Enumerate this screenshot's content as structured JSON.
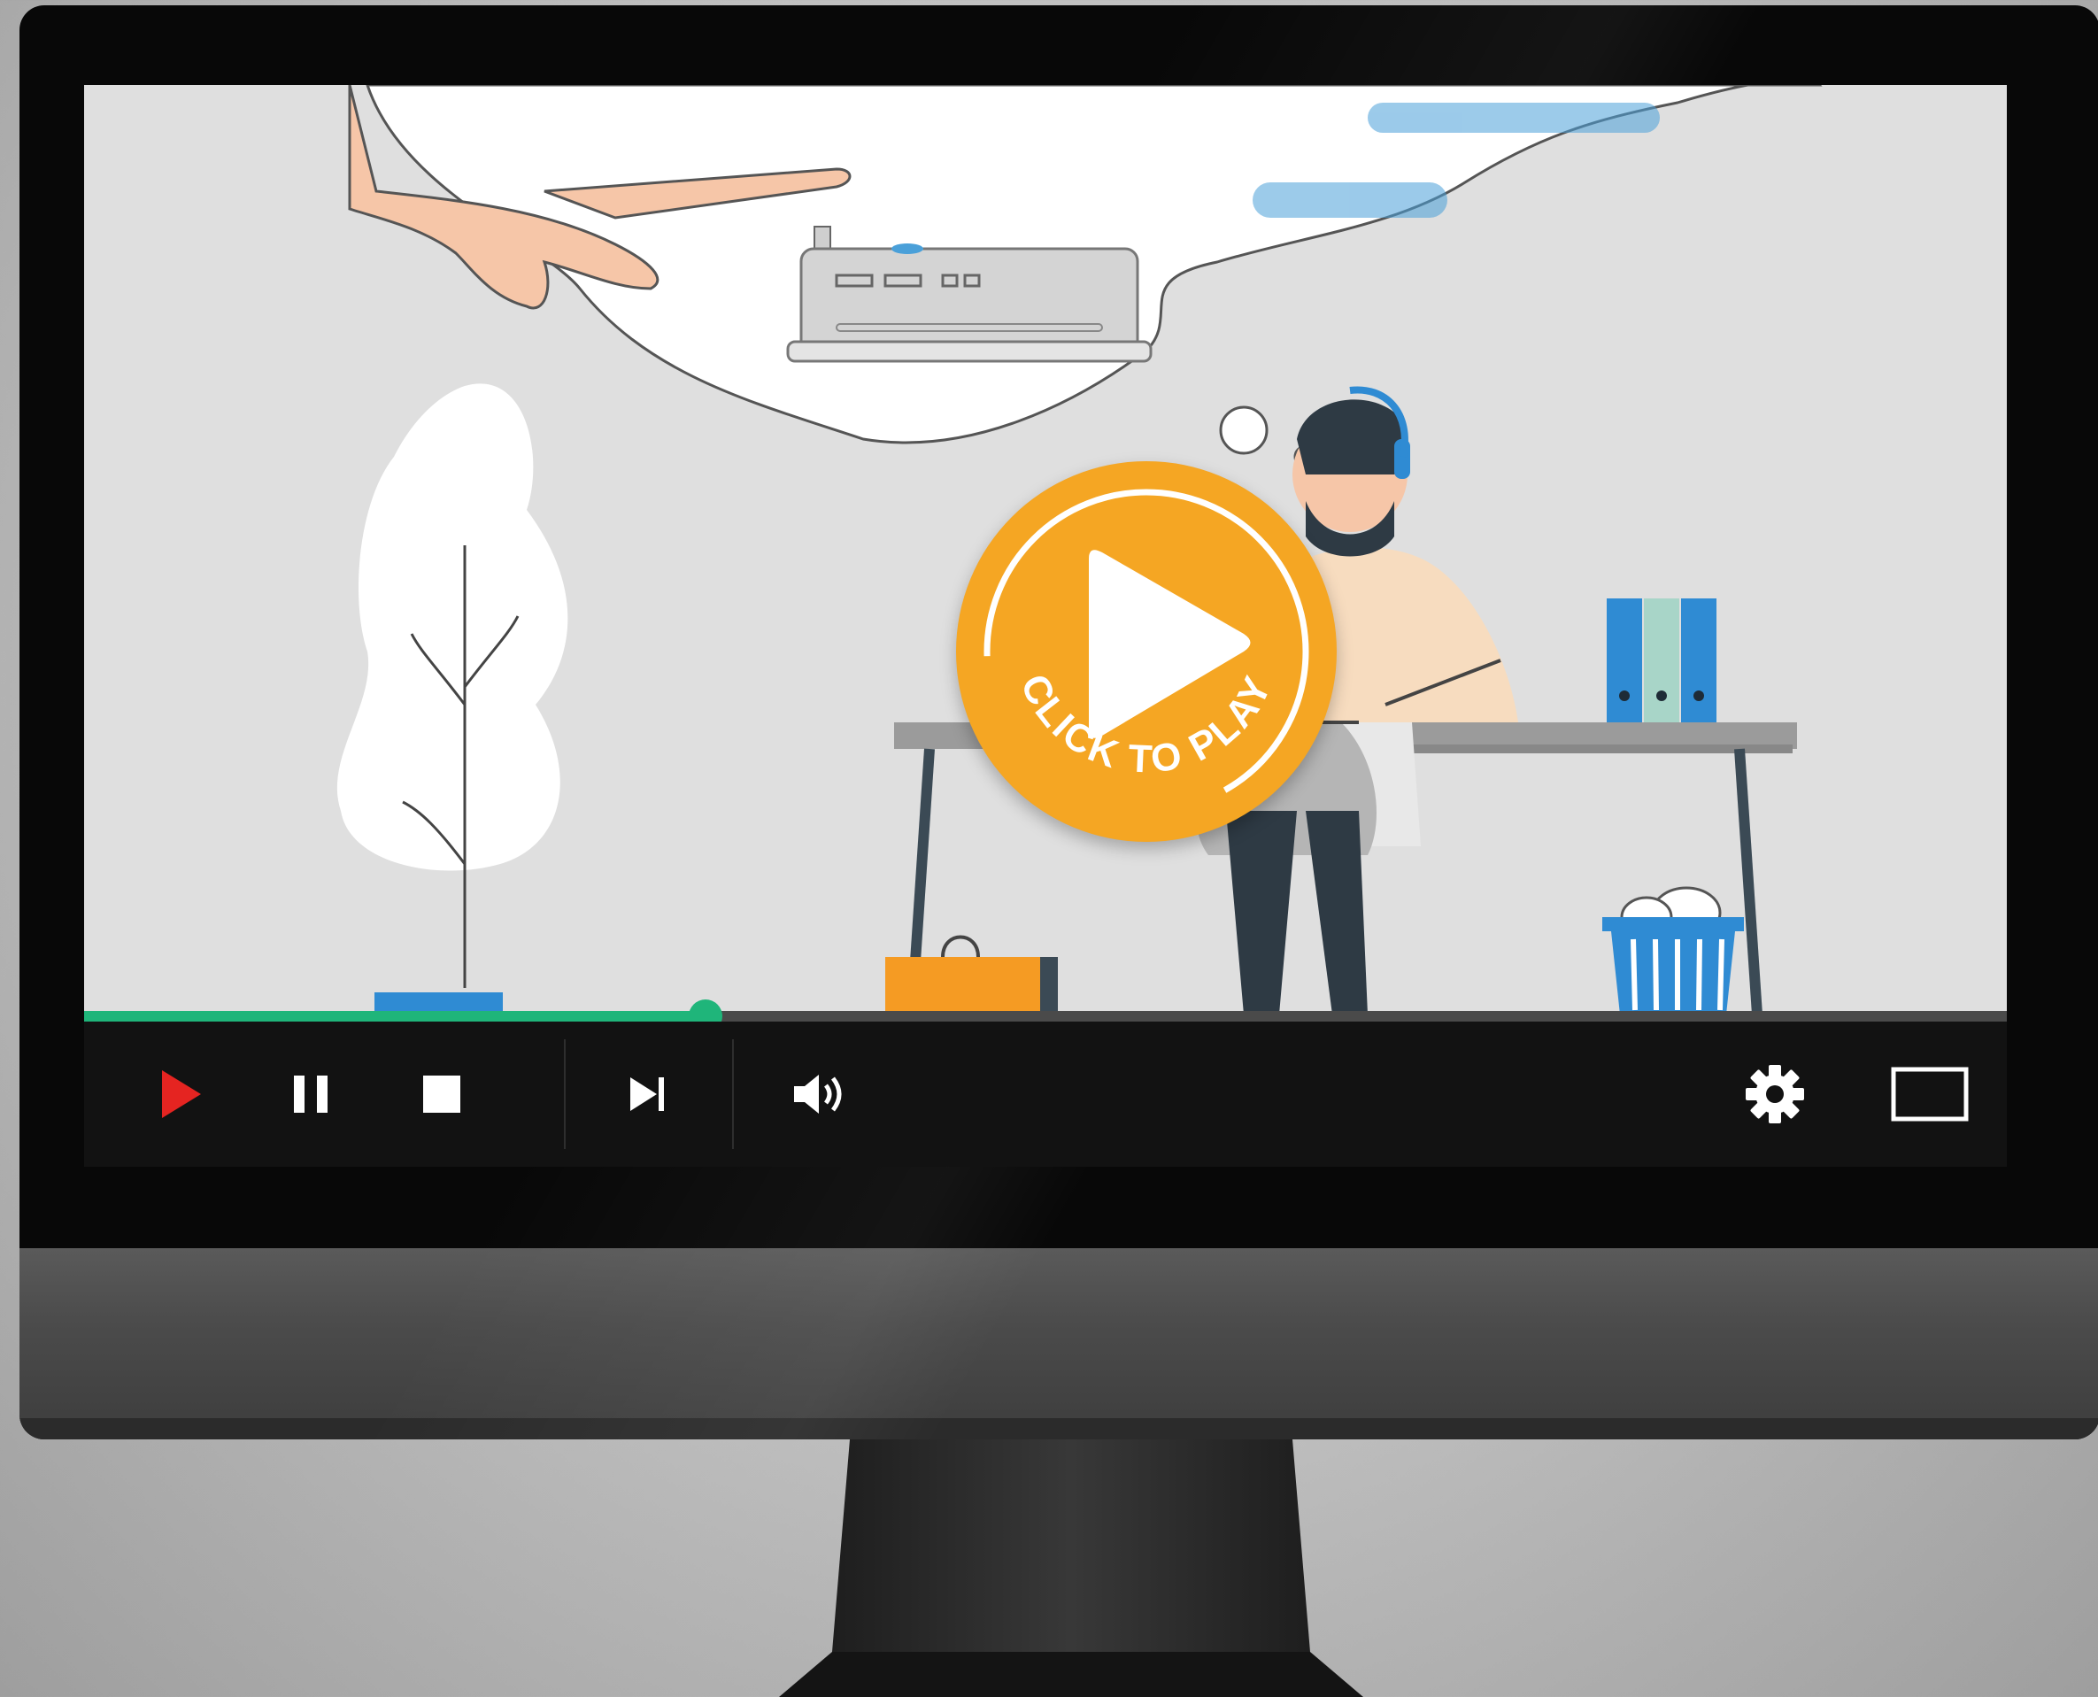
{
  "overlay": {
    "play_caption": "CLICK TO PLAY",
    "play_color": "#f5a623"
  },
  "player": {
    "progress": 0.323,
    "progress_color": "#1fb57a",
    "controls": [
      {
        "name": "play-icon",
        "color": "#e52421"
      },
      {
        "name": "pause-icon",
        "color": "#ffffff"
      },
      {
        "name": "stop-icon",
        "color": "#ffffff"
      },
      {
        "name": "skip-next-icon",
        "color": "#ffffff"
      },
      {
        "name": "volume-icon",
        "color": "#ffffff"
      },
      {
        "name": "gear-icon",
        "color": "#ffffff"
      },
      {
        "name": "fullscreen-icon",
        "color": "#ffffff"
      }
    ]
  },
  "scene": {
    "icons": [
      "pointing-hand",
      "router",
      "thought-bubble",
      "plant",
      "support-agent",
      "desk",
      "laptop",
      "binders",
      "briefcase",
      "trash-basket"
    ]
  }
}
